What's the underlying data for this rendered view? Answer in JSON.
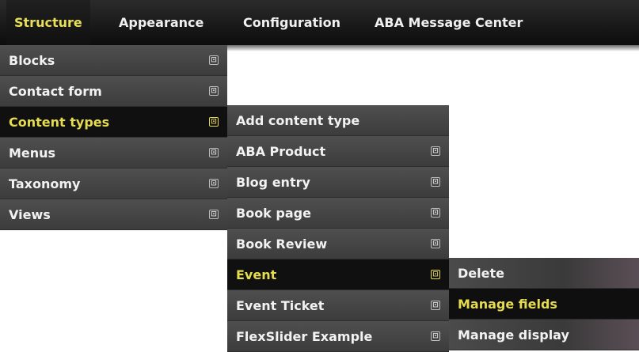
{
  "topnav": [
    {
      "label": "Structure",
      "active": true
    },
    {
      "label": "Appearance",
      "active": false
    },
    {
      "label": "Configuration",
      "active": false
    },
    {
      "label": "ABA Message Center",
      "active": false
    }
  ],
  "menu_structure": [
    {
      "label": "Blocks",
      "arrow": "⊡"
    },
    {
      "label": "Contact form",
      "arrow": "⊡"
    },
    {
      "label": "Content types",
      "arrow": "⊡",
      "active": true
    },
    {
      "label": "Menus",
      "arrow": "⊡"
    },
    {
      "label": "Taxonomy",
      "arrow": "⊡"
    },
    {
      "label": "Views",
      "arrow": "⊡"
    }
  ],
  "menu_content_types": [
    {
      "label": "Add content type"
    },
    {
      "label": "ABA Product",
      "arrow": "⊡"
    },
    {
      "label": "Blog entry",
      "arrow": "⊡"
    },
    {
      "label": "Book page",
      "arrow": "⊡"
    },
    {
      "label": "Book Review",
      "arrow": "⊡"
    },
    {
      "label": "Event",
      "arrow": "⊡",
      "active": true
    },
    {
      "label": "Event Ticket",
      "arrow": "⊡"
    },
    {
      "label": "FlexSlider Example",
      "arrow": "⊡"
    }
  ],
  "menu_event": [
    {
      "label": "Delete"
    },
    {
      "label": "Manage fields",
      "active": true
    },
    {
      "label": "Manage display"
    }
  ],
  "colors": {
    "accent": "#e6dc4f",
    "menu_bg": "#4a4a4a",
    "active_bg": "#101010"
  }
}
